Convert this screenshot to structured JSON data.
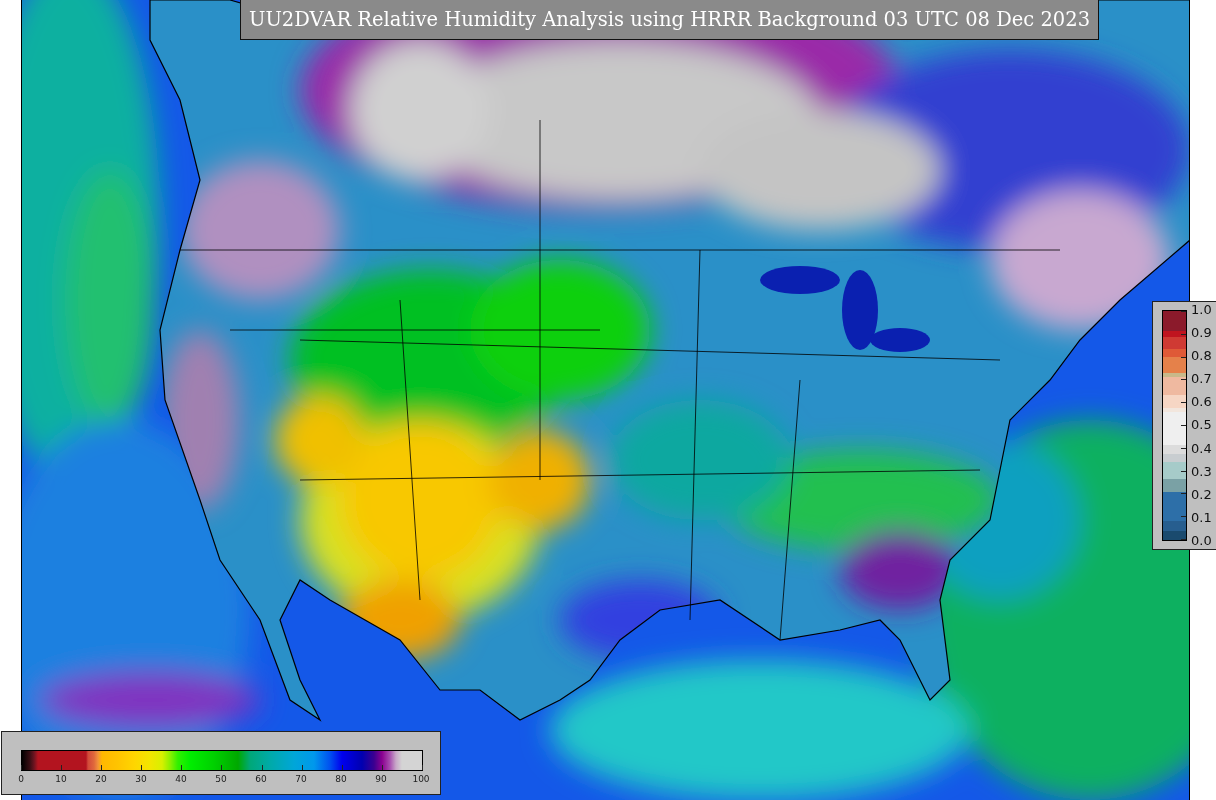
{
  "map": {
    "title": "UU2DVAR Relative Humidity Analysis using HRRR Background 03 UTC 08 Dec 2023"
  },
  "observation_colorbar": {
    "tick_labels": [
      "1.0",
      "0.9",
      "0.8",
      "0.7",
      "0.6",
      "0.5",
      "0.4",
      "0.3",
      "0.2",
      "0.1",
      "0.0"
    ]
  },
  "analysis_colorbar": {
    "tick_labels": [
      "0",
      "10",
      "20",
      "30",
      "40",
      "50",
      "60",
      "70",
      "80",
      "90",
      "100"
    ]
  }
}
